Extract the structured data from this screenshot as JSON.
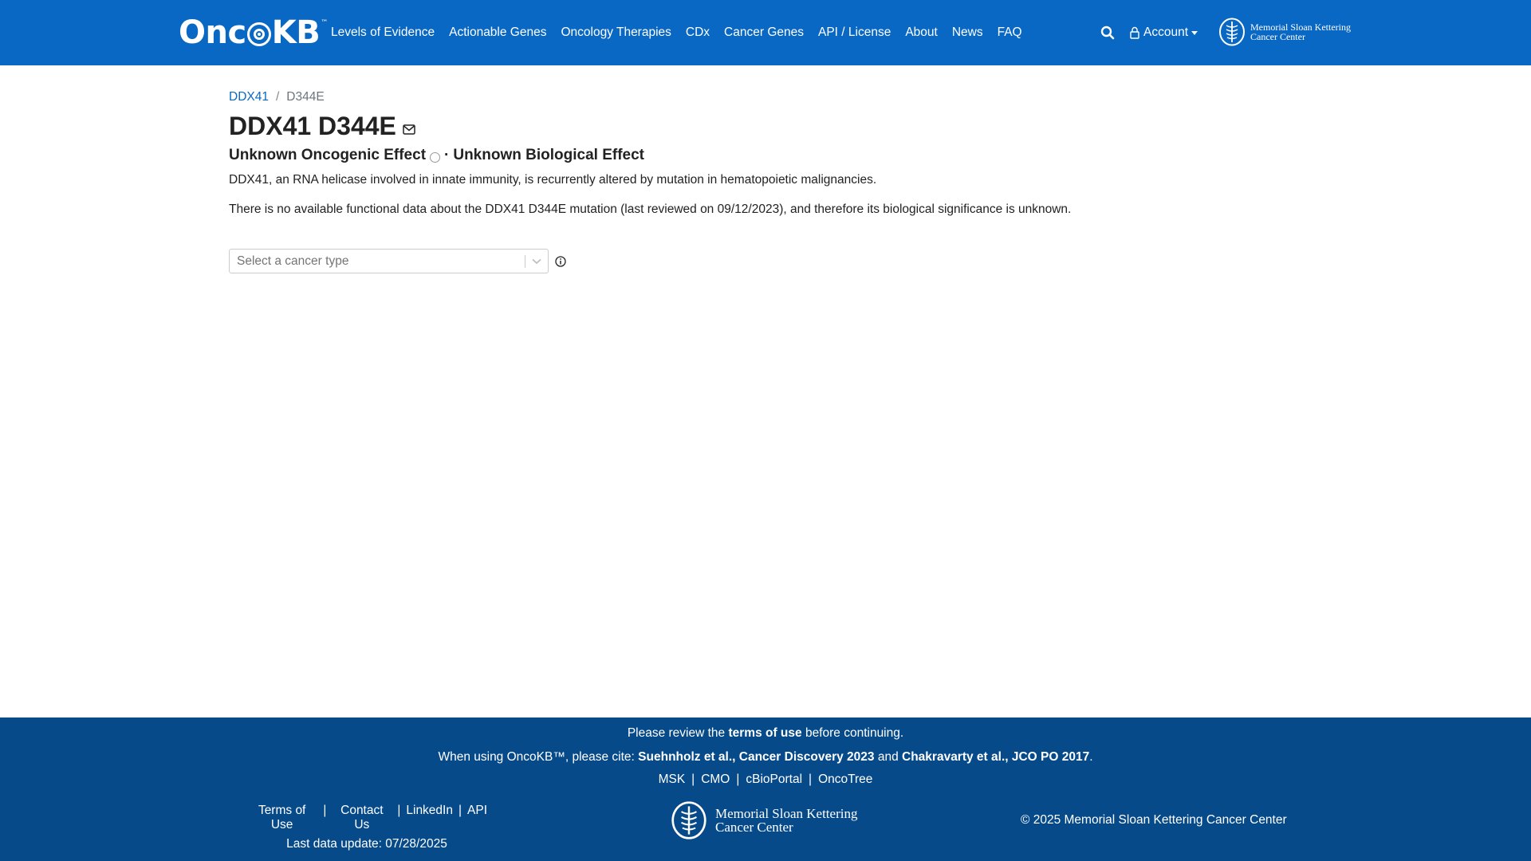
{
  "nav": {
    "brand": {
      "prefix": "Onc",
      "suffix": "KB",
      "tm": "™"
    },
    "links": [
      "Levels of Evidence",
      "Actionable Genes",
      "Oncology Therapies",
      "CDx",
      "Cancer Genes",
      "API / License",
      "About",
      "News",
      "FAQ"
    ],
    "account_label": "Account",
    "msk_logo": {
      "line1": "Memorial Sloan Kettering",
      "line2": "Cancer Center"
    }
  },
  "breadcrumb": {
    "gene": "DDX41",
    "separator": "/",
    "current": "D344E"
  },
  "title": "DDX41 D344E",
  "subtitle": {
    "oncogenic": "Unknown Oncogenic Effect",
    "separator": "·",
    "biological": "Unknown Biological Effect"
  },
  "descriptions": [
    "DDX41, an RNA helicase involved in innate immunity, is recurrently altered by mutation in hematopoietic malignancies.",
    "There is no available functional data about the DDX41 D344E mutation (last reviewed on 09/12/2023), and therefore its biological significance is unknown."
  ],
  "cancer_select": {
    "placeholder": "Select a cancer type"
  },
  "footer": {
    "terms": {
      "before": "Please review the ",
      "link": "terms of use",
      "after": " before continuing."
    },
    "cite": {
      "before": "When using OncoKB™, please cite: ",
      "ref1": "Suehnholz et al., Cancer Discovery 2023",
      "and": " and ",
      "ref2": "Chakravarty et al., JCO PO 2017",
      "end": "."
    },
    "links": [
      "MSK",
      "CMO",
      "cBioPortal",
      "OncoTree"
    ],
    "left_links": [
      "Terms of Use",
      "Contact Us",
      "LinkedIn",
      "API"
    ],
    "last_update": "Last data update: 07/28/2025",
    "msk_logo": {
      "line1": "Memorial Sloan Kettering",
      "line2": "Cancer Center"
    },
    "copyright": "© 2025 Memorial Sloan Kettering Cancer Center"
  },
  "colors": {
    "navbar": "#0968c3",
    "footer": "#064a8a",
    "link": "#0968c3"
  }
}
